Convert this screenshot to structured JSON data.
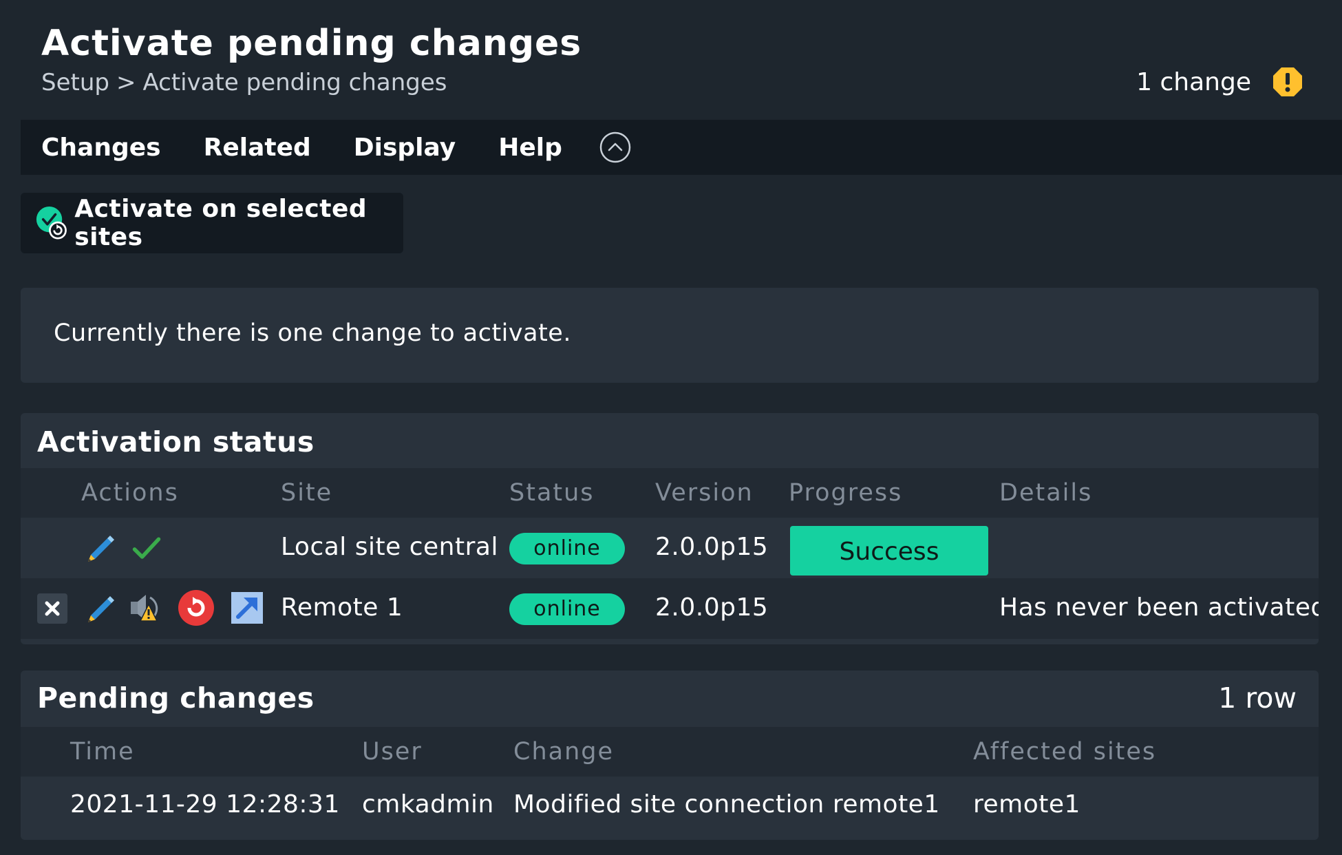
{
  "header": {
    "title": "Activate pending changes",
    "breadcrumb": [
      "Setup",
      ">",
      "Activate pending changes"
    ],
    "change_counter": "1 change",
    "warning_icon": "warning-icon"
  },
  "menubar": {
    "items": [
      "Changes",
      "Related",
      "Display",
      "Help"
    ],
    "collapse_icon": "chevron-up-circle-icon"
  },
  "activate_button": {
    "label": "Activate on selected sites",
    "icon": "activate-check-icon"
  },
  "info": {
    "message": "Currently there is one change to activate."
  },
  "activation_status": {
    "title": "Activation status",
    "columns": [
      "Actions",
      "Site",
      "Status",
      "Version",
      "Progress",
      "Details"
    ],
    "rows": [
      {
        "actions": [
          "edit-pencil-icon",
          "ok-check-icon"
        ],
        "site": "Local site central",
        "status": "online",
        "version": "2.0.0p15",
        "progress": "Success",
        "details": ""
      },
      {
        "actions": [
          "remove-x-icon",
          "edit-pencil-icon",
          "warning-volume-icon",
          "restart-icon",
          "open-link-icon"
        ],
        "site": "Remote 1",
        "status": "online",
        "version": "2.0.0p15",
        "progress": "",
        "details": "Has never been activated"
      }
    ]
  },
  "pending_changes": {
    "title": "Pending changes",
    "row_count": "1 row",
    "columns": [
      "Time",
      "User",
      "Change",
      "Affected sites"
    ],
    "rows": [
      {
        "time": "2021-11-29 12:28:31",
        "user": "cmkadmin",
        "change": "Modified site connection remote1",
        "affected_sites": "remote1"
      }
    ]
  },
  "colors": {
    "background": "#1e262e",
    "menubar": "#131a21",
    "panel": "#29323c",
    "accent_green": "#15d1a0",
    "warning_yellow": "#ffc02e",
    "danger_red": "#e83a3a",
    "pencil_blue": "#2d8ed8"
  }
}
